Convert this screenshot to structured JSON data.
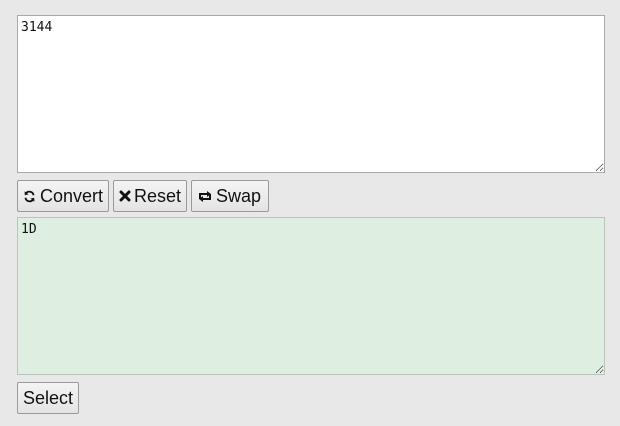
{
  "input": {
    "value": "3144"
  },
  "toolbar": {
    "convert_label": "Convert",
    "convert_icon": "refresh-icon",
    "reset_label": "Reset",
    "reset_icon": "close-icon",
    "swap_label": "Swap",
    "swap_icon": "swap-icon"
  },
  "output": {
    "value": "1D"
  },
  "select_label": "Select",
  "colors": {
    "page_background": "#e8e8e8",
    "input_background": "#ffffff",
    "output_background": "#deeee0"
  }
}
